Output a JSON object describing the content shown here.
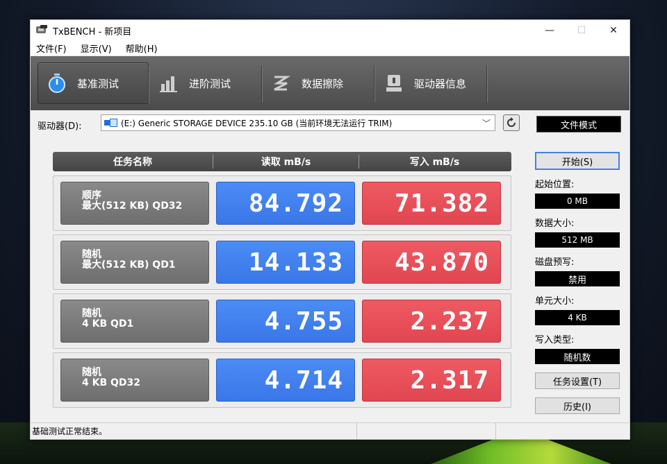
{
  "window": {
    "title": "TxBENCH - 新项目",
    "minimize": "—",
    "maximize": "☐",
    "close": "✕"
  },
  "menu": [
    {
      "label": "文件(F)"
    },
    {
      "label": "显示(V)"
    },
    {
      "label": "帮助(H)"
    }
  ],
  "tabs": [
    {
      "label": "基准测试",
      "icon": "stopwatch-icon",
      "active": true
    },
    {
      "label": "进阶测试",
      "icon": "bar-chart-icon",
      "active": false
    },
    {
      "label": "数据擦除",
      "icon": "erase-icon",
      "active": false
    },
    {
      "label": "驱动器信息",
      "icon": "drive-info-icon",
      "active": false
    }
  ],
  "drive": {
    "label": "驱动器(D):",
    "selected": "(E:) Generic STORAGE DEVICE  235.10 GB (当前环境无法运行 TRIM)"
  },
  "file_mode": "文件模式",
  "grid": {
    "headers": [
      "任务名称",
      "读取 mB/s",
      "写入 mB/s"
    ],
    "rows": [
      {
        "name": "顺序",
        "sub": "最大(512 KB) QD32",
        "read": "84.792",
        "write": "71.382"
      },
      {
        "name": "随机",
        "sub": "最大(512 KB) QD1",
        "read": "14.133",
        "write": "43.870"
      },
      {
        "name": "随机",
        "sub": "4 KB QD1",
        "read": "4.755",
        "write": "2.237"
      },
      {
        "name": "随机",
        "sub": "4 KB QD32",
        "read": "4.714",
        "write": "2.317"
      }
    ]
  },
  "panel": {
    "start": "开始(S)",
    "start_pos_label": "起始位置:",
    "start_pos": "0 MB",
    "data_size_label": "数据大小:",
    "data_size": "512 MB",
    "prefill_label": "磁盘预写:",
    "prefill": "禁用",
    "unit_size_label": "单元大小:",
    "unit_size": "4 KB",
    "write_type_label": "写入类型:",
    "write_type": "随机数",
    "task_settings": "任务设置(T)",
    "history": "历史(I)"
  },
  "status": "基础测试正常结束。",
  "colors": {
    "read": "#3a76e8",
    "write": "#e14651",
    "tabbar": "#4b4b4b"
  }
}
